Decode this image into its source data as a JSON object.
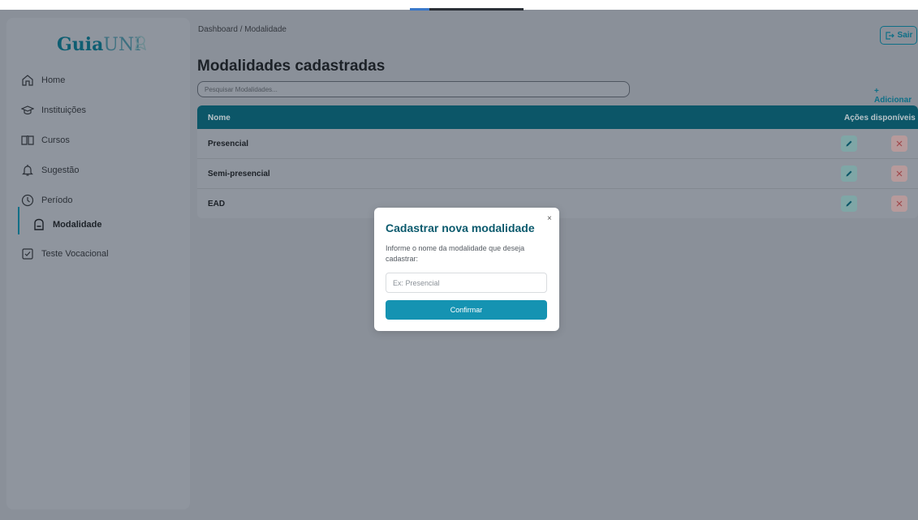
{
  "app": {
    "logo_main": "Guia",
    "logo_accent": "UNI"
  },
  "sidebar": {
    "items": [
      {
        "label": "Home",
        "icon": "home-icon"
      },
      {
        "label": "Instituições",
        "icon": "graduation-cap-icon"
      },
      {
        "label": "Cursos",
        "icon": "book-icon"
      },
      {
        "label": "Sugestão",
        "icon": "bell-icon"
      },
      {
        "label": "Período",
        "icon": "clock-icon"
      },
      {
        "label": "Modalidade",
        "icon": "bag-icon",
        "active": true
      },
      {
        "label": "Teste Vocacional",
        "icon": "checkbox-icon"
      }
    ]
  },
  "header": {
    "breadcrumb": "Dashboard / Modalidade",
    "title": "Modalidades cadastradas",
    "exit_label": "Sair"
  },
  "search": {
    "placeholder": "Pesquisar Modalidades..."
  },
  "add_label": "+ Adicionar",
  "table": {
    "columns": [
      "Nome",
      "Ações disponíveis"
    ],
    "rows": [
      {
        "name": "Presencial"
      },
      {
        "name": "Semi-presencial"
      },
      {
        "name": "EAD"
      }
    ]
  },
  "modal": {
    "close": "×",
    "title": "Cadastrar nova modalidade",
    "text": "Informe o nome da modalidade que deseja cadastrar:",
    "input_placeholder": "Ex: Presencial",
    "confirm_label": "Confirmar"
  },
  "colors": {
    "accent": "#0d6f87",
    "header": "#0c5668",
    "confirm": "#1593b2",
    "overlay": "#8a9099"
  }
}
